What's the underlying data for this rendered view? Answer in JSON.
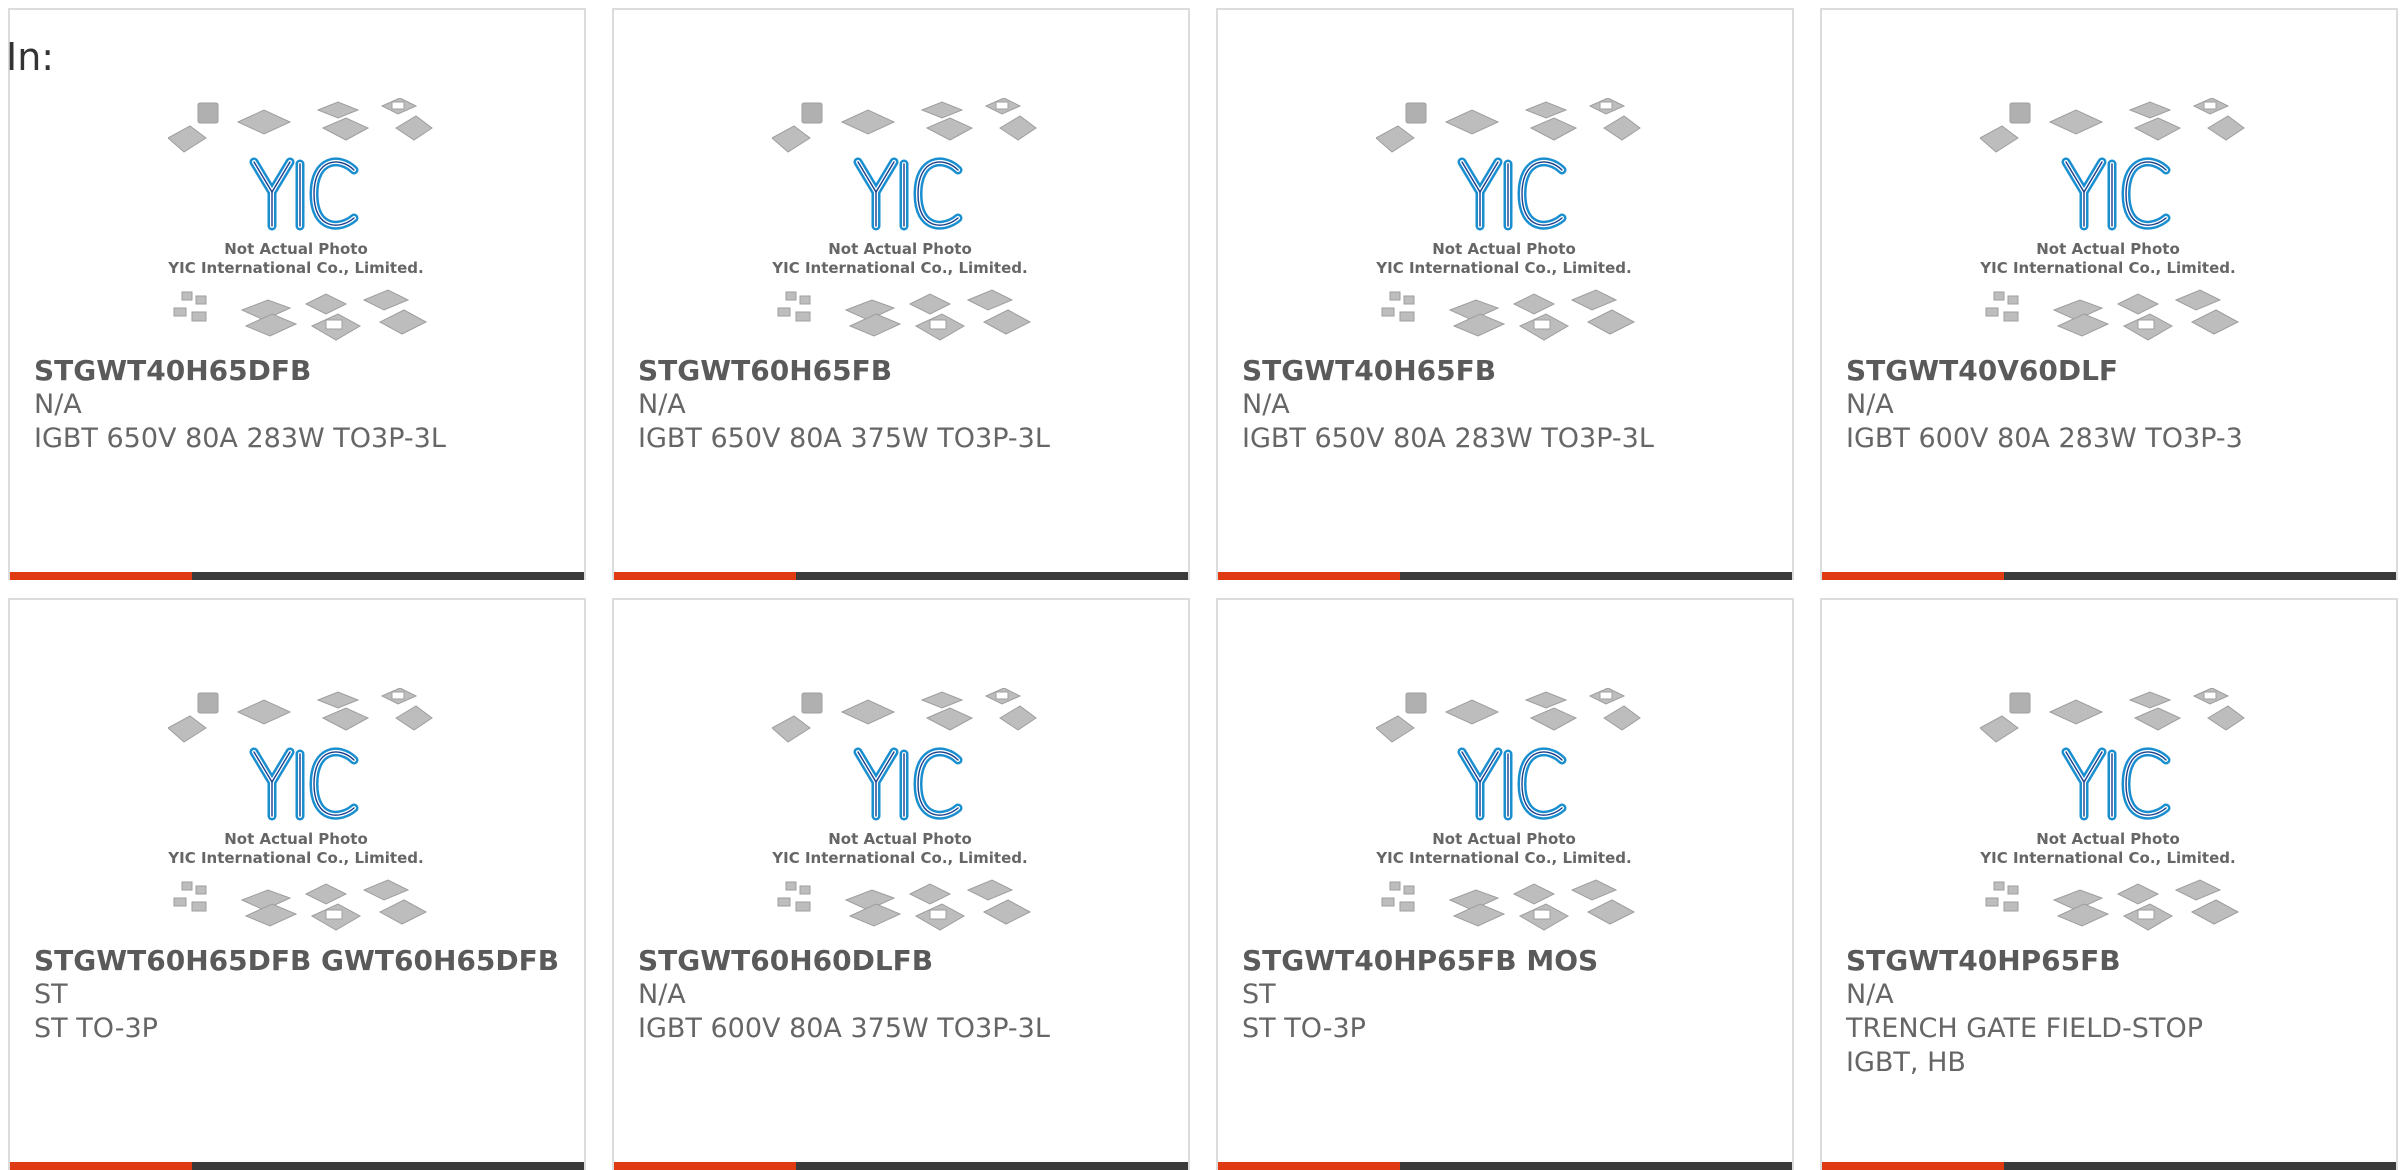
{
  "header": {
    "in_label": "In:"
  },
  "photo_placeholder": {
    "brand": "YIC",
    "line1": "Not Actual Photo",
    "line2": "YIC International Co., Limited."
  },
  "colors": {
    "accent": "#e03a12",
    "bar": "#3a3a3a",
    "logo_blue": "#1a8fd0",
    "logo_dark": "#1c3f8a",
    "text": "#666666",
    "border": "#dcdcdc"
  },
  "products": [
    {
      "part": "STGWT40H65DFB",
      "manufacturer": "N/A",
      "description": "IGBT 650V 80A 283W TO3P-3L"
    },
    {
      "part": "STGWT60H65FB",
      "manufacturer": "N/A",
      "description": "IGBT 650V 80A 375W TO3P-3L"
    },
    {
      "part": "STGWT40H65FB",
      "manufacturer": "N/A",
      "description": "IGBT 650V 80A 283W TO3P-3L"
    },
    {
      "part": "STGWT40V60DLF",
      "manufacturer": "N/A",
      "description": "IGBT 600V 80A 283W TO3P-3"
    },
    {
      "part": "STGWT60H65DFB GWT60H65DFB",
      "manufacturer": "ST",
      "description": "ST TO-3P"
    },
    {
      "part": "STGWT60H60DLFB",
      "manufacturer": "N/A",
      "description": "IGBT 600V 80A 375W TO3P-3L"
    },
    {
      "part": "STGWT40HP65FB MOS",
      "manufacturer": "ST",
      "description": "ST TO-3P"
    },
    {
      "part": "STGWT40HP65FB",
      "manufacturer": "N/A",
      "description": "TRENCH GATE FIELD-STOP IGBT, HB"
    }
  ]
}
